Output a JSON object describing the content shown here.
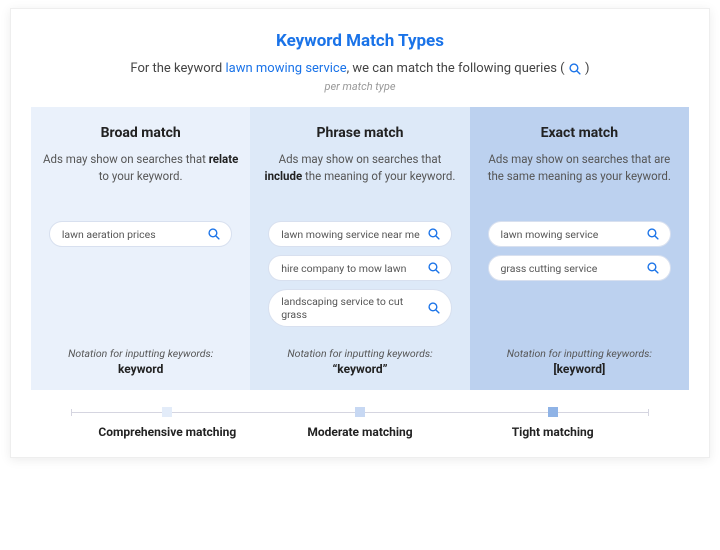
{
  "title": "Keyword Match Types",
  "subtitle_pre": "For the keyword ",
  "subtitle_keyword": "lawn mowing service",
  "subtitle_post": ", we can match the following queries ( ",
  "subtitle_close": " )",
  "subsub": "per match type",
  "notation_label": "Notation for inputting keywords:",
  "columns": {
    "broad": {
      "title": "Broad match",
      "desc_pre": "Ads may show on searches that ",
      "desc_bold": "relate",
      "desc_post": " to your keyword.",
      "pills": [
        "lawn aeration prices"
      ],
      "notation": "keyword"
    },
    "phrase": {
      "title": "Phrase match",
      "desc_pre": "Ads may show on searches that ",
      "desc_bold": "include",
      "desc_post": " the meaning of your keyword.",
      "pills": [
        "lawn mowing service near me",
        "hire company to mow lawn",
        "landscaping service to cut grass"
      ],
      "notation": "“keyword”"
    },
    "exact": {
      "title": "Exact match",
      "desc_pre": "Ads may show on searches that are the same meaning as your keyword.",
      "desc_bold": "",
      "desc_post": "",
      "pills": [
        "lawn mowing service",
        "grass cutting service"
      ],
      "notation": "[keyword]"
    }
  },
  "scale": {
    "labels": [
      "Comprehensive matching",
      "Moderate matching",
      "Tight matching"
    ]
  }
}
